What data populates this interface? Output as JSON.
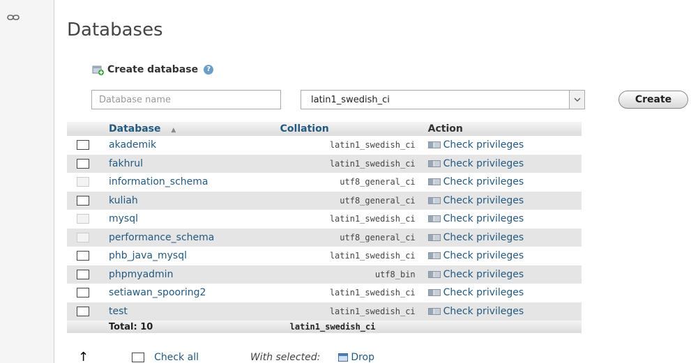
{
  "page": {
    "title": "Databases"
  },
  "create": {
    "heading": "Create database",
    "help": "?",
    "name_placeholder": "Database name",
    "collation_selected": "latin1_swedish_ci",
    "button_label": "Create"
  },
  "table": {
    "headers": {
      "database": "Database",
      "sort_indicator": "▲",
      "collation": "Collation",
      "action": "Action"
    },
    "action_label": "Check privileges",
    "rows": [
      {
        "name": "akademik",
        "collation": "latin1_swedish_ci",
        "disabled": false
      },
      {
        "name": "fakhrul",
        "collation": "latin1_swedish_ci",
        "disabled": false
      },
      {
        "name": "information_schema",
        "collation": "utf8_general_ci",
        "disabled": true
      },
      {
        "name": "kuliah",
        "collation": "utf8_general_ci",
        "disabled": false
      },
      {
        "name": "mysql",
        "collation": "latin1_swedish_ci",
        "disabled": true
      },
      {
        "name": "performance_schema",
        "collation": "utf8_general_ci",
        "disabled": true
      },
      {
        "name": "phb_java_mysql",
        "collation": "latin1_swedish_ci",
        "disabled": false
      },
      {
        "name": "phpmyadmin",
        "collation": "utf8_bin",
        "disabled": false
      },
      {
        "name": "setiawan_spooring2",
        "collation": "latin1_swedish_ci",
        "disabled": false
      },
      {
        "name": "test",
        "collation": "latin1_swedish_ci",
        "disabled": false
      }
    ],
    "total_label": "Total: 10",
    "total_collation": "latin1_swedish_ci"
  },
  "footer": {
    "arrow": "↑",
    "check_all": "Check all",
    "with_selected": "With selected:",
    "drop": "Drop"
  },
  "colors": {
    "link": "#235a81",
    "row_alt": "#e5e5e5"
  }
}
